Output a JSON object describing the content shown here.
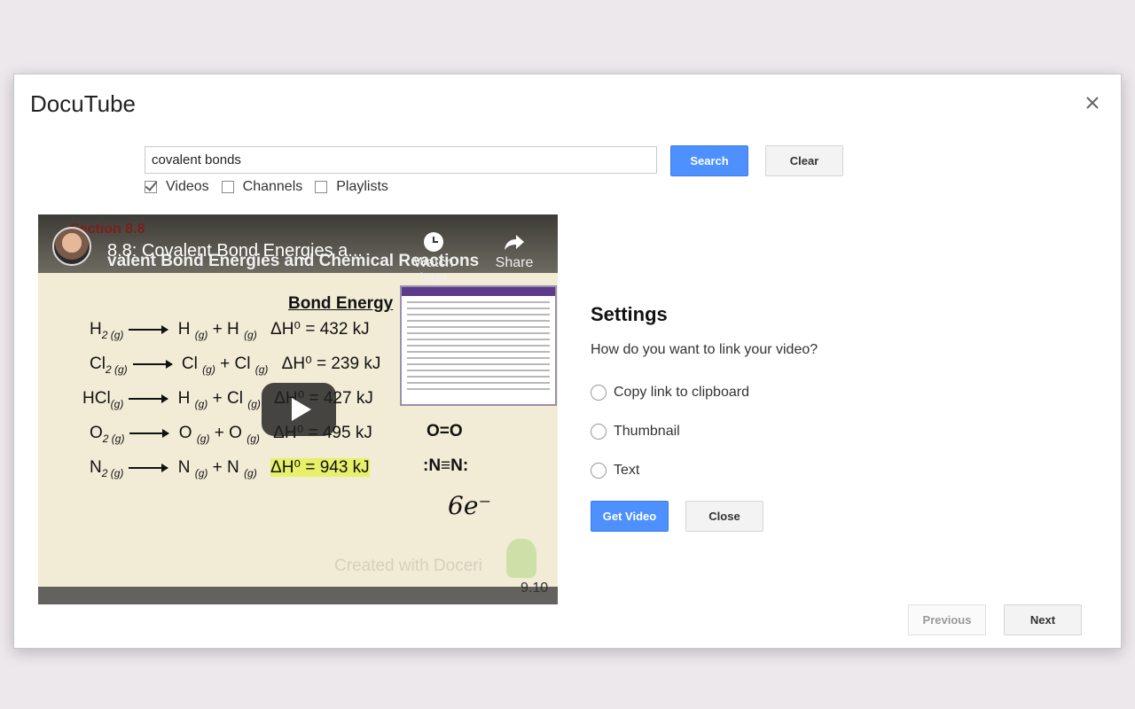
{
  "dialog": {
    "title": "DocuTube"
  },
  "search": {
    "value": "covalent bonds",
    "search_label": "Search",
    "clear_label": "Clear",
    "filters": [
      {
        "label": "Videos",
        "checked": true
      },
      {
        "label": "Channels",
        "checked": false
      },
      {
        "label": "Playlists",
        "checked": false
      }
    ]
  },
  "video": {
    "title": "8.8: Covalent Bond Energies a...",
    "overlay_section": "Section 8.8",
    "overlay_subtitle": "valent Bond Energies and Chemical Reactions",
    "watch_later_label": "Watch later",
    "share_label": "Share",
    "bond_heading": "Bond Energy",
    "equations": [
      {
        "reactant": "H",
        "r_sub": "2 (g)",
        "p1": "H",
        "p1_sub": "(g)",
        "p2": "H",
        "p2_sub": "(g)",
        "dh": "ΔH⁰ = 432 kJ"
      },
      {
        "reactant": "Cl",
        "r_sub": "2 (g)",
        "p1": "Cl",
        "p1_sub": "(g)",
        "p2": "Cl",
        "p2_sub": "(g)",
        "dh": "ΔH⁰ = 239 kJ"
      },
      {
        "reactant": "HCl",
        "r_sub": "(g)",
        "p1": "H",
        "p1_sub": "(g)",
        "p2": "Cl",
        "p2_sub": "(g)",
        "dh": "ΔH⁰ = 427 kJ"
      },
      {
        "reactant": "O",
        "r_sub": "2 (g)",
        "p1": "O",
        "p1_sub": "(g)",
        "p2": "O",
        "p2_sub": "(g)",
        "dh": "ΔH⁰ = 495 kJ"
      },
      {
        "reactant": "N",
        "r_sub": "2 (g)",
        "p1": "N",
        "p1_sub": "(g)",
        "p2": "N",
        "p2_sub": "(g)",
        "dh": "ΔH⁰ = 943 kJ"
      }
    ],
    "lewis_o2": "O=O",
    "lewis_n2": ":N≡N:",
    "handwriting": "6e⁻",
    "watermark": "Created with Doceri",
    "timecode": "9.10"
  },
  "settings": {
    "title": "Settings",
    "question": "How do you want to link your video?",
    "options": [
      "Copy link to clipboard",
      "Thumbnail",
      "Text"
    ],
    "get_video_label": "Get Video",
    "close_label": "Close"
  },
  "pager": {
    "previous_label": "Previous",
    "next_label": "Next"
  }
}
